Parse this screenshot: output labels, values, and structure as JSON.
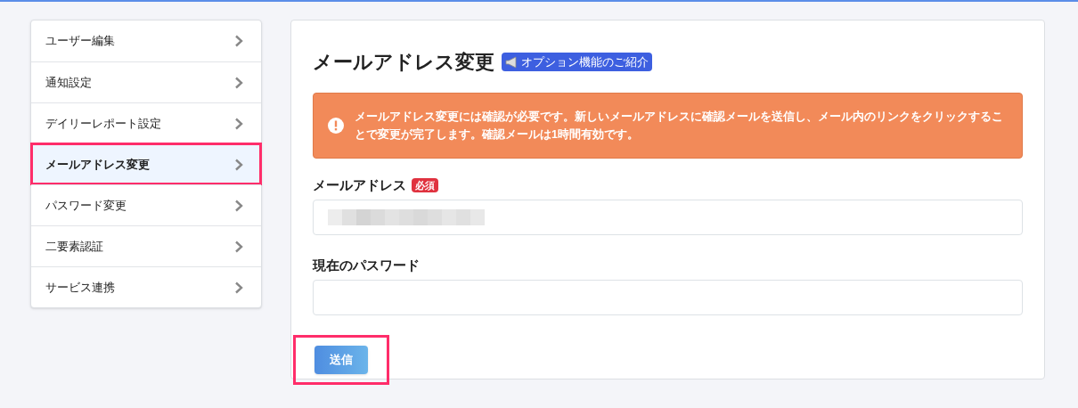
{
  "sidebar": {
    "items": [
      {
        "label": "ユーザー編集",
        "selected": false,
        "highlighted": false
      },
      {
        "label": "通知設定",
        "selected": false,
        "highlighted": false
      },
      {
        "label": "デイリーレポート設定",
        "selected": false,
        "highlighted": false
      },
      {
        "label": "メールアドレス変更",
        "selected": true,
        "highlighted": true
      },
      {
        "label": "パスワード変更",
        "selected": false,
        "highlighted": false
      },
      {
        "label": "二要素認証",
        "selected": false,
        "highlighted": false
      },
      {
        "label": "サービス連携",
        "selected": false,
        "highlighted": false
      }
    ]
  },
  "main": {
    "title": "メールアドレス変更",
    "badge": "オプション機能のご紹介",
    "alert": "メールアドレス変更には確認が必要です。新しいメールアドレスに確認メールを送信し、メール内のリンクをクリックすることで変更が完了します。確認メールは1時間有効です。",
    "fields": [
      {
        "label": "メールアドレス",
        "required_badge": "必須",
        "redacted": true
      },
      {
        "label": "現在のパスワード",
        "redacted": false
      }
    ],
    "submit": {
      "label": "送信",
      "highlighted": true
    }
  }
}
